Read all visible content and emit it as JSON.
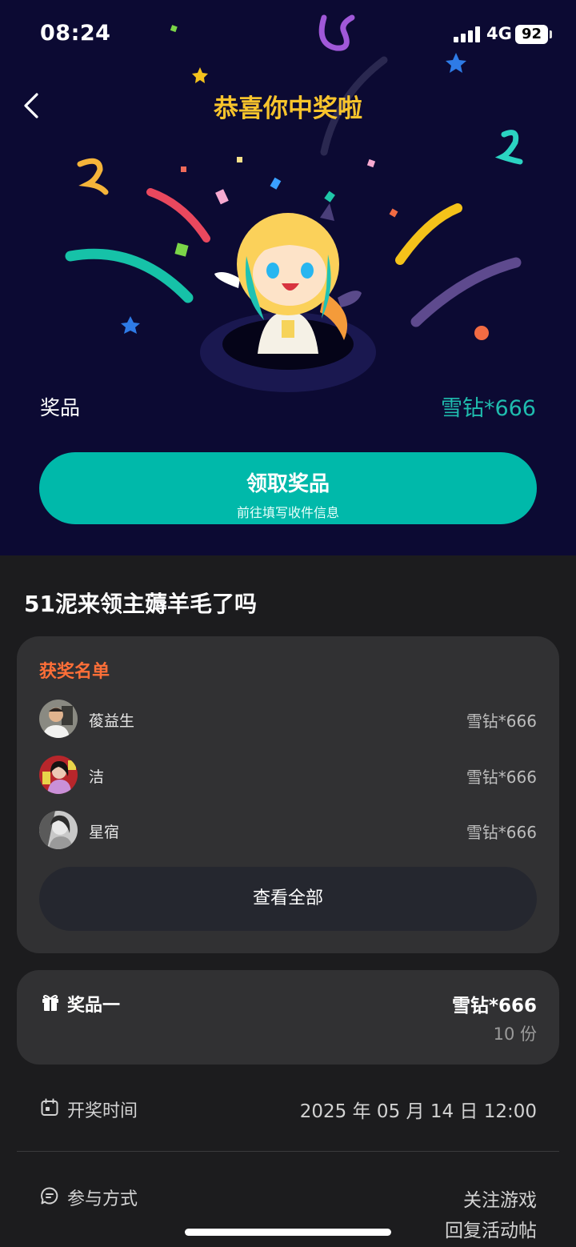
{
  "status_bar": {
    "time": "08:24",
    "network": "4G",
    "battery": "92"
  },
  "header": {
    "back_icon": "chevron-left-icon",
    "title": "恭喜你中奖啦"
  },
  "prize": {
    "label": "奖品",
    "value": "雪钻*666"
  },
  "claim_button": {
    "label": "领取奖品",
    "sublabel": "前往填写收件信息"
  },
  "event": {
    "title": "51泥来领主薅羊毛了吗"
  },
  "winners": {
    "title": "获奖名单",
    "list": [
      {
        "name": "葰益生",
        "prize": "雪钻*666"
      },
      {
        "name": "洁",
        "prize": "雪钻*666"
      },
      {
        "name": "星宿",
        "prize": "雪钻*666"
      }
    ],
    "view_all": "查看全部"
  },
  "prize_item": {
    "icon": "gift-icon",
    "name": "奖品一",
    "amount": "雪钻*666",
    "quantity": "10 份"
  },
  "draw_time": {
    "icon": "calendar-icon",
    "label": "开奖时间",
    "value": "2025 年 05 月 14 日 12:00"
  },
  "participation": {
    "icon": "comment-icon",
    "label": "参与方式",
    "methods": [
      "关注游戏",
      "回复活动帖"
    ]
  },
  "colors": {
    "hero_bg": "#0c0a33",
    "accent_teal": "#00b9aa",
    "title_gold": "#f8c42c",
    "winners_orange": "#ff6f38",
    "page_bg": "#1c1c1e",
    "card_bg": "#313133"
  }
}
